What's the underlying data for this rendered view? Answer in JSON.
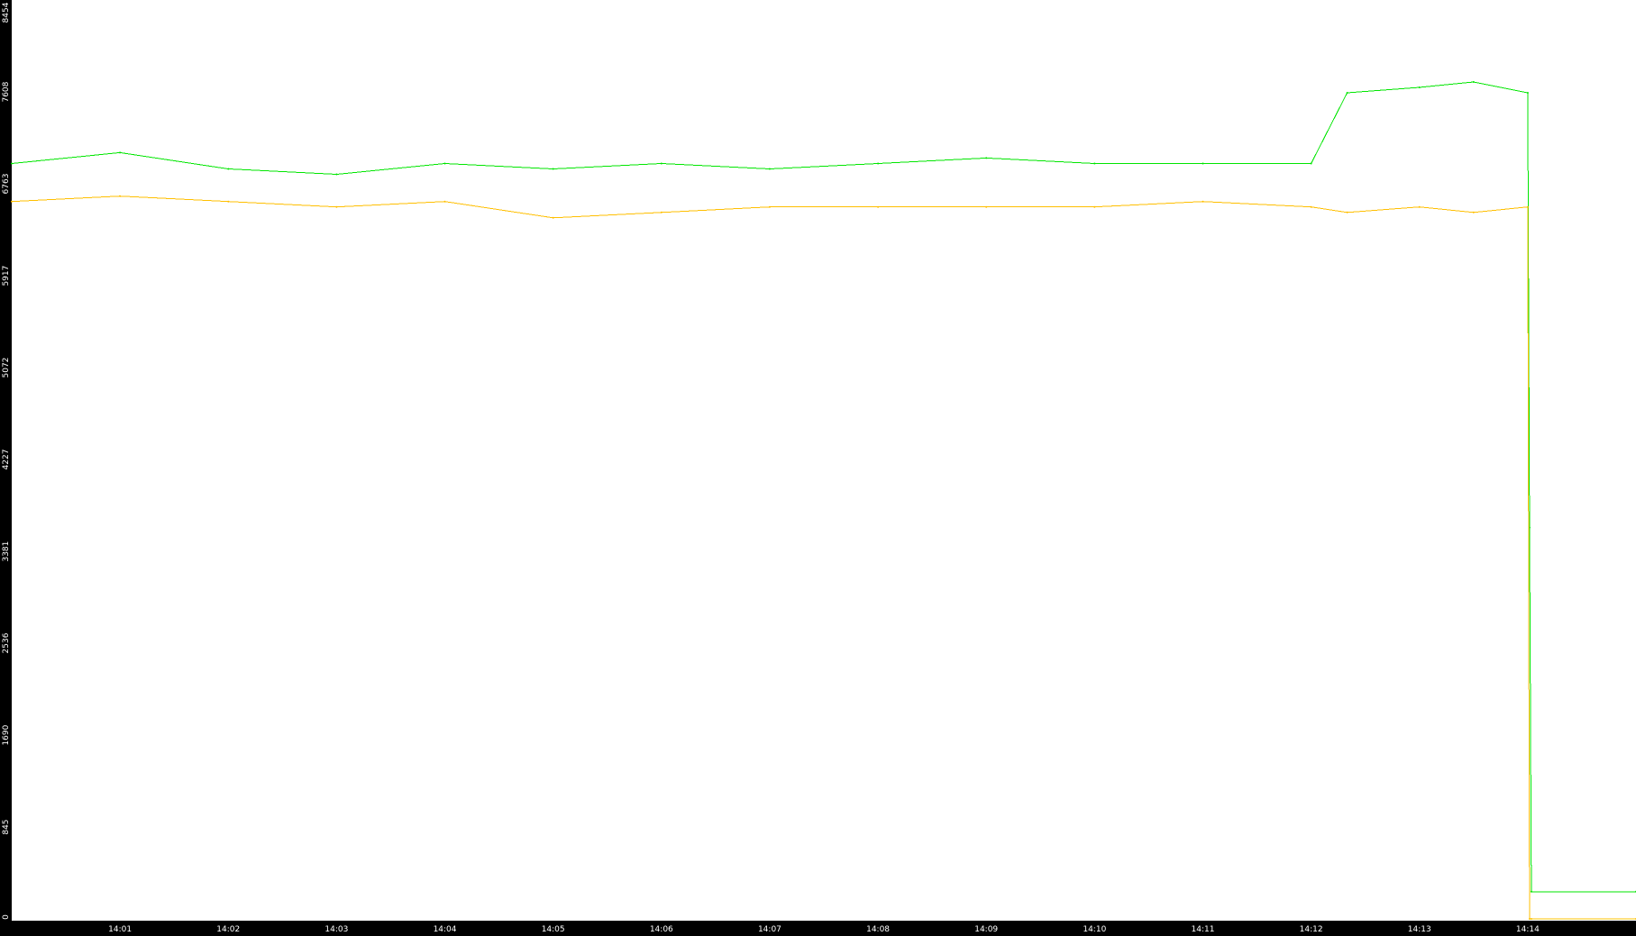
{
  "chart_data": {
    "type": "line",
    "title": "",
    "xlabel": "",
    "ylabel": "",
    "ylim": [
      0,
      8454
    ],
    "yticks": [
      "0",
      "845",
      "1690",
      "2536",
      "3381",
      "4227",
      "5072",
      "5917",
      "6763",
      "7608",
      "8454"
    ],
    "xlim": [
      "14:00",
      "14:15"
    ],
    "xticks": [
      "14:01",
      "14:02",
      "14:03",
      "14:04",
      "14:05",
      "14:06",
      "14:07",
      "14:08",
      "14:09",
      "14:10",
      "14:11",
      "14:12",
      "14:13",
      "14:14"
    ],
    "grid": false,
    "legend": "none",
    "background": "#ffffff",
    "axis_background": "#000000",
    "x": [
      "14:00",
      "14:01",
      "14:02",
      "14:03",
      "14:04",
      "14:05",
      "14:06",
      "14:07",
      "14:08",
      "14:09",
      "14:10",
      "14:11",
      "14:12",
      "14:12:20",
      "14:13",
      "14:13:30",
      "14:14",
      "14:14:01",
      "14:14:02",
      "14:15"
    ],
    "series": [
      {
        "color": "#00e600",
        "values": [
          6950,
          7050,
          6900,
          6850,
          6950,
          6900,
          6950,
          6900,
          6950,
          7000,
          6950,
          6950,
          6950,
          7600,
          7650,
          7700,
          7600,
          3600,
          250,
          250
        ]
      },
      {
        "color": "#ffbf00",
        "values": [
          6600,
          6650,
          6600,
          6550,
          6600,
          6450,
          6500,
          6550,
          6550,
          6550,
          6550,
          6600,
          6550,
          6500,
          6550,
          6500,
          6550,
          0,
          0,
          0
        ]
      }
    ]
  }
}
